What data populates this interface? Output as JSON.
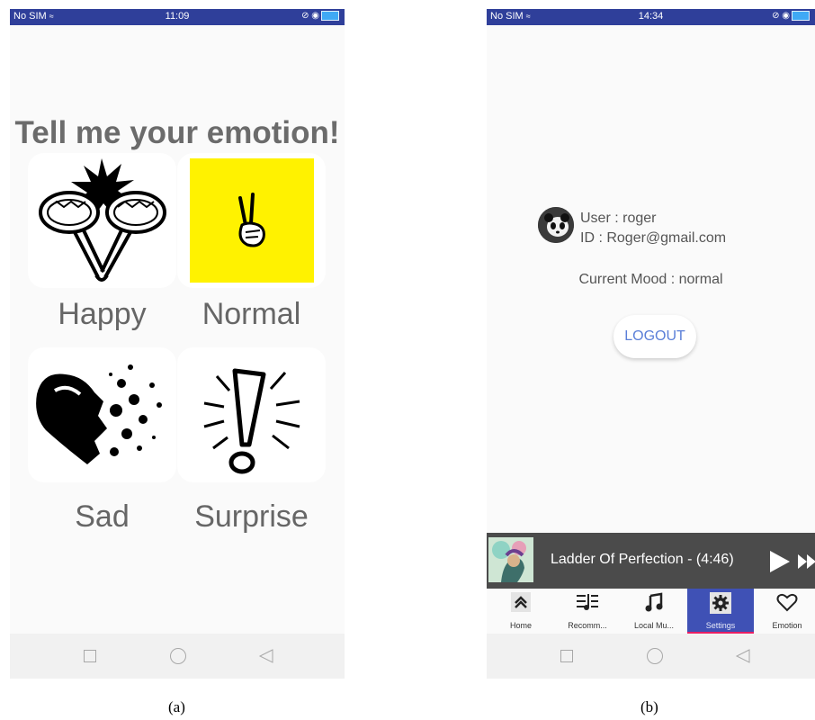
{
  "phone_a": {
    "status": {
      "carrier": "No SIM",
      "time": "11:09"
    },
    "title": "Tell me your emotion!",
    "emotions": [
      {
        "label": "Happy",
        "icon": "maracas-icon"
      },
      {
        "label": "Normal",
        "icon": "victory-hand-icon"
      },
      {
        "label": "Sad",
        "icon": "broken-heart-icon"
      },
      {
        "label": "Surprise",
        "icon": "exclamation-icon"
      }
    ],
    "caption": "(a)"
  },
  "phone_b": {
    "status": {
      "carrier": "No SIM",
      "time": "14:34"
    },
    "user_line": "User : roger",
    "id_line": "ID : Roger@gmail.com",
    "mood": "Current Mood : normal",
    "logout_label": "LOGOUT",
    "player": {
      "track": "Ladder Of Perfection - (4:46)"
    },
    "nav": [
      {
        "label": "Home",
        "icon": "home-icon"
      },
      {
        "label": "Recomm...",
        "icon": "playlist-icon"
      },
      {
        "label": "Local Mu...",
        "icon": "music-note-icon"
      },
      {
        "label": "Settings",
        "icon": "gear-icon",
        "active": true
      },
      {
        "label": "Emotion",
        "icon": "heart-icon"
      }
    ],
    "caption": "(b)"
  },
  "colors": {
    "status_bar": "#2f3f9a",
    "active_tab": "#3f51b5",
    "indicator": "#e91e63",
    "logout_text": "#5b7fd8",
    "normal_tile": "#fff200"
  }
}
